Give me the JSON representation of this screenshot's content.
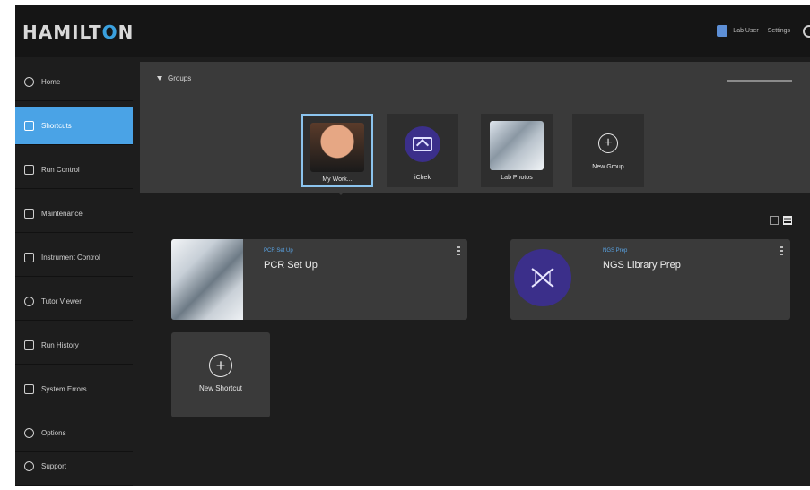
{
  "brand": {
    "logo_left": "HAMILT",
    "logo_o": "O",
    "logo_right": "N"
  },
  "header": {
    "user1": "Lab User",
    "user2": "Settings"
  },
  "sidebar": {
    "items": [
      {
        "label": "Home",
        "icon": "home-icon"
      },
      {
        "label": "Shortcuts",
        "icon": "shortcuts-icon",
        "active": true
      },
      {
        "label": "Run Control",
        "icon": "run-control-icon"
      },
      {
        "label": "Maintenance",
        "icon": "maintenance-icon"
      },
      {
        "label": "Instrument Control",
        "icon": "instrument-control-icon"
      },
      {
        "label": "Tutor Viewer",
        "icon": "tutor-viewer-icon"
      },
      {
        "label": "Run History",
        "icon": "run-history-icon"
      },
      {
        "label": "System Errors",
        "icon": "system-errors-icon"
      },
      {
        "label": "Options",
        "icon": "options-icon"
      },
      {
        "label": "Support",
        "icon": "support-icon"
      }
    ]
  },
  "groups": {
    "title": "Groups",
    "tiles": [
      {
        "label": "My Work...",
        "kind": "photo-person",
        "selected": true
      },
      {
        "label": "iChek",
        "kind": "icon-monitor"
      },
      {
        "label": "Lab Photos",
        "kind": "photo-lab"
      },
      {
        "label": "New Group",
        "kind": "new"
      }
    ]
  },
  "shortcuts": [
    {
      "category": "PCR Set Up",
      "title": "PCR Set Up",
      "thumb": "lab-photo"
    },
    {
      "category": "NGS Prep",
      "title": "NGS Library Prep",
      "thumb": "dna-icon"
    }
  ],
  "new_shortcut": {
    "label": "New Shortcut"
  }
}
